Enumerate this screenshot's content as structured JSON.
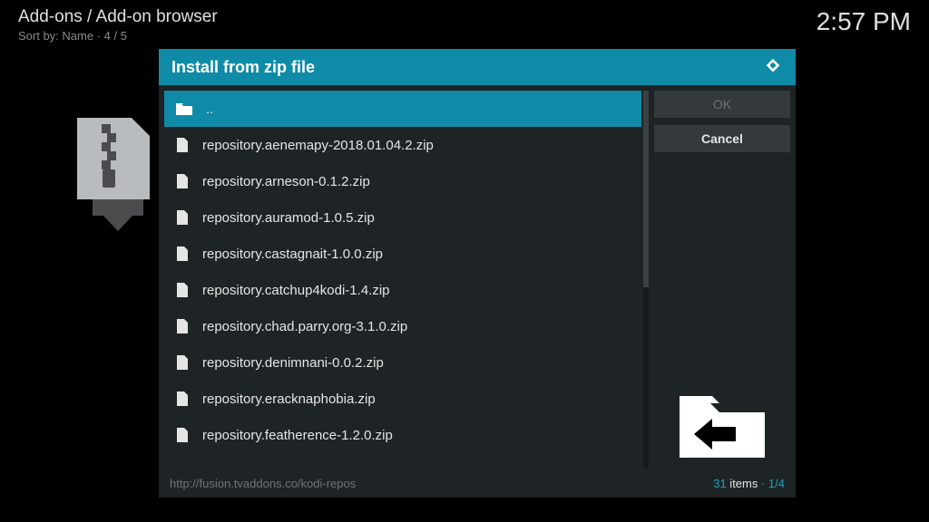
{
  "header": {
    "title": "Add-ons / Add-on browser",
    "sort": "Sort by: Name  ·  4 / 5"
  },
  "clock": "2:57 PM",
  "dialog": {
    "title": "Install from zip file"
  },
  "files": {
    "up": "..",
    "items": [
      "repository.aenemapy-2018.01.04.2.zip",
      "repository.arneson-0.1.2.zip",
      "repository.auramod-1.0.5.zip",
      "repository.castagnait-1.0.0.zip",
      "repository.catchup4kodi-1.4.zip",
      "repository.chad.parry.org-3.1.0.zip",
      "repository.denimnani-0.0.2.zip",
      "repository.eracknaphobia.zip",
      "repository.featherence-1.2.0.zip"
    ]
  },
  "buttons": {
    "ok": "OK",
    "cancel": "Cancel"
  },
  "footer": {
    "path": "http://fusion.tvaddons.co/kodi-repos",
    "count": "31",
    "count_label": " items",
    "page": "1/4"
  }
}
